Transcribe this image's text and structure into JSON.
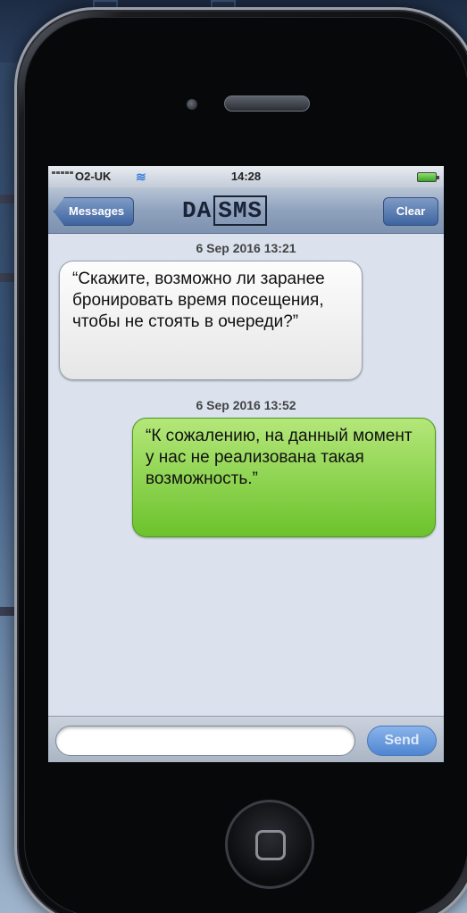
{
  "status_bar": {
    "carrier": "O2-UK",
    "time": "14:28"
  },
  "nav_bar": {
    "back_label": "Messages",
    "logo_prefix": "DA",
    "logo_boxed": "SMS",
    "clear_label": "Clear"
  },
  "thread": {
    "messages": [
      {
        "timestamp": "6 Sep 2016 13:21",
        "direction": "incoming",
        "text": "“Скажите, возможно ли заранее бронировать время посещения, чтобы не стоять в очереди?”"
      },
      {
        "timestamp": "6 Sep 2016 13:52",
        "direction": "outgoing",
        "text": "“К сожалению, на данный момент у нас не реализована такая возможность.”"
      }
    ]
  },
  "input_bar": {
    "placeholder": "",
    "send_label": "Send"
  },
  "colors": {
    "incoming_bubble": "#f2f2f2",
    "outgoing_bubble": "#8fd44a",
    "send_button": "#6b9ee0",
    "nav_bar": "#8fa2bd"
  },
  "icons": [
    "signal-icon",
    "wifi-icon",
    "battery-icon",
    "home-button-icon"
  ]
}
